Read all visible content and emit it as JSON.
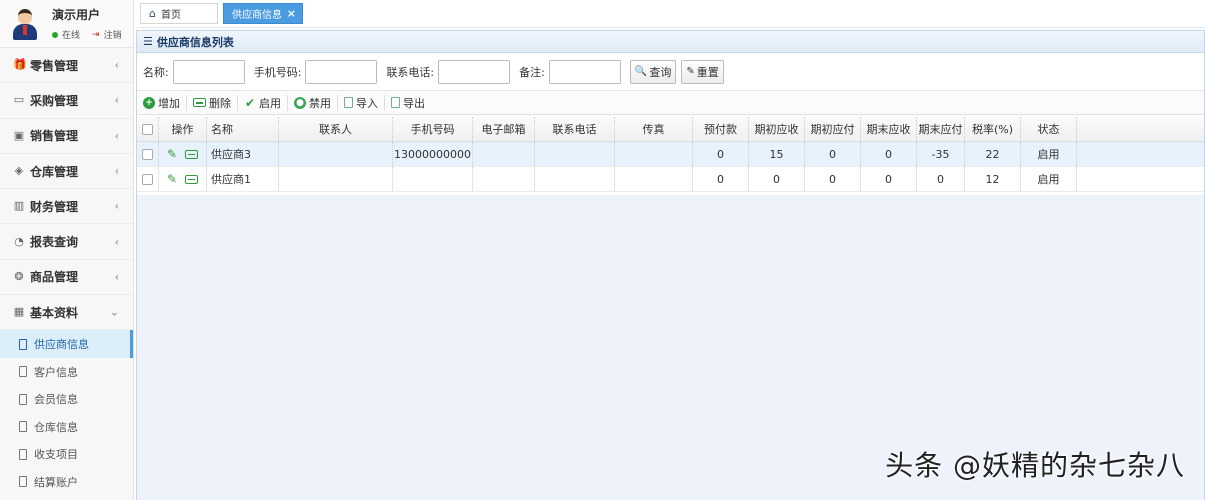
{
  "user": {
    "name": "演示用户",
    "status": "在线",
    "logout": "注销"
  },
  "sidebar": {
    "menus": [
      {
        "label": "零售管理",
        "icon": "gift-icon",
        "glyph": "🎁"
      },
      {
        "label": "采购管理",
        "icon": "monitor-icon",
        "glyph": "▭"
      },
      {
        "label": "销售管理",
        "icon": "briefcase-icon",
        "glyph": "▣"
      },
      {
        "label": "仓库管理",
        "icon": "layers-icon",
        "glyph": "◈"
      },
      {
        "label": "财务管理",
        "icon": "map-icon",
        "glyph": "▥"
      },
      {
        "label": "报表查询",
        "icon": "pie-icon",
        "glyph": "◔"
      },
      {
        "label": "商品管理",
        "icon": "tags-icon",
        "glyph": "❂"
      },
      {
        "label": "基本资料",
        "icon": "grid-icon",
        "glyph": "▦"
      }
    ],
    "subitems": [
      "供应商信息",
      "客户信息",
      "会员信息",
      "仓库信息",
      "收支项目",
      "结算账户"
    ]
  },
  "tabs": {
    "home": "首页",
    "active": "供应商信息",
    "close": "×"
  },
  "panel": {
    "title": "供应商信息列表"
  },
  "search": {
    "name_label": "名称:",
    "phone_label": "手机号码:",
    "tel_label": "联系电话:",
    "remark_label": "备注:",
    "query": "查询",
    "reset": "重置"
  },
  "toolbar": {
    "add": "增加",
    "delete": "删除",
    "enable": "启用",
    "disable": "禁用",
    "import": "导入",
    "export": "导出"
  },
  "table": {
    "columns": [
      "操作",
      "名称",
      "联系人",
      "手机号码",
      "电子邮箱",
      "联系电话",
      "传真",
      "预付款",
      "期初应收",
      "期初应付",
      "期末应收",
      "期末应付",
      "税率(%)",
      "状态"
    ],
    "rows": [
      [
        "",
        "供应商3",
        "",
        "13000000000",
        "",
        "",
        "",
        "0",
        "15",
        "0",
        "0",
        "-35",
        "22",
        "启用"
      ],
      [
        "",
        "供应商1",
        "",
        "",
        "",
        "",
        "",
        "0",
        "0",
        "0",
        "0",
        "0",
        "12",
        "启用"
      ]
    ]
  },
  "watermark": "头条 @妖精的杂七杂八"
}
